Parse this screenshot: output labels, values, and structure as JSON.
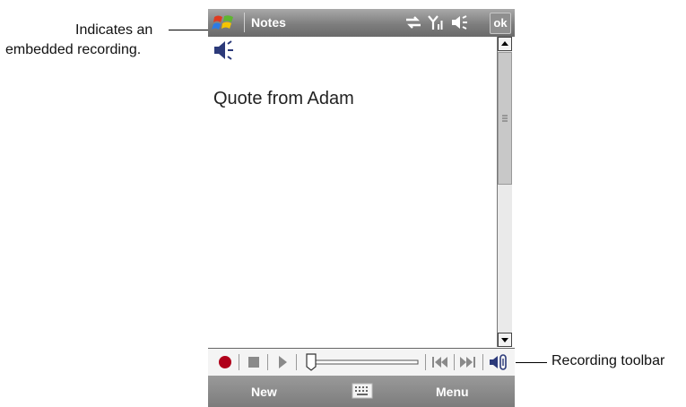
{
  "annotations": {
    "embedded_line1": "Indicates an",
    "embedded_line2": "embedded recording.",
    "toolbar": "Recording toolbar"
  },
  "titlebar": {
    "title": "Notes",
    "ok_label": "ok"
  },
  "note": {
    "text": "Quote from Adam"
  },
  "menubar": {
    "left_softkey": "New",
    "right_softkey": "Menu"
  },
  "recording": {
    "position": 0.0
  },
  "colors": {
    "record": "#b0001a",
    "titlebar": "#8a8a8a",
    "icon_blue": "#2c3a7a"
  },
  "icons": [
    "start-icon",
    "sync-icon",
    "signal-icon",
    "volume-icon",
    "speaker-icon",
    "record-icon",
    "stop-icon",
    "play-icon",
    "skip-back-icon",
    "skip-forward-icon",
    "recorder-icon",
    "keyboard-icon"
  ]
}
